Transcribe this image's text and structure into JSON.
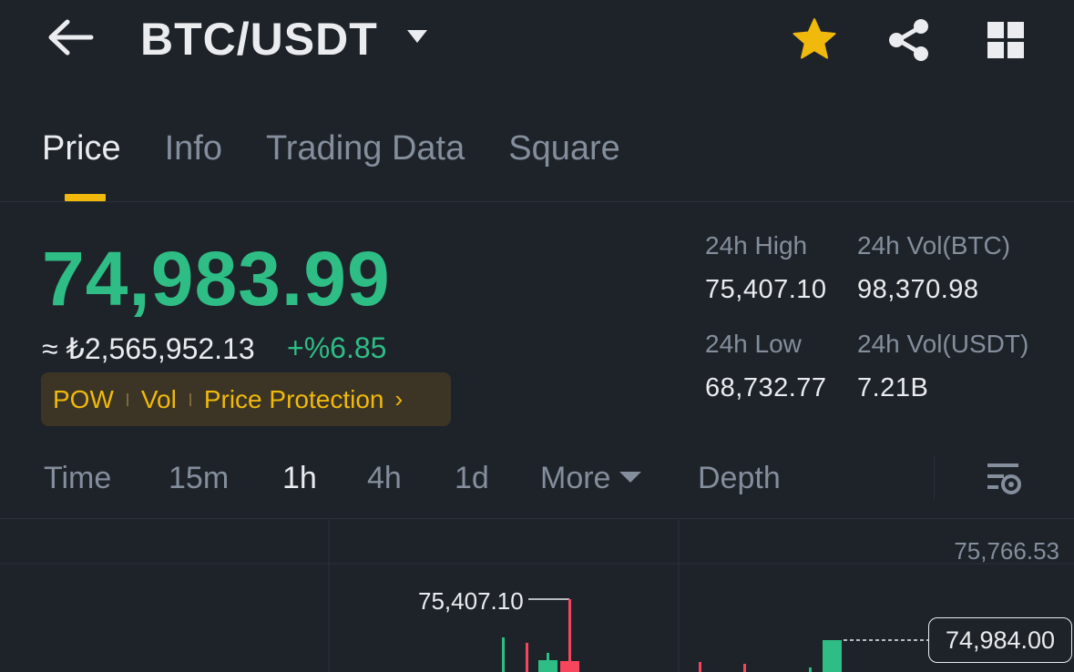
{
  "header": {
    "pair": "BTC/USDT",
    "icons": [
      "back-arrow-icon",
      "caret-down-icon",
      "star-icon",
      "share-icon",
      "grid-icon"
    ],
    "favorite_color": "#f0b90b"
  },
  "tabs": [
    {
      "label": "Price",
      "active": true
    },
    {
      "label": "Info",
      "active": false
    },
    {
      "label": "Trading Data",
      "active": false
    },
    {
      "label": "Square",
      "active": false
    }
  ],
  "price": {
    "last": "74,983.99",
    "fiat": "≈ ₺2,565,952.13",
    "change": "+%6.85",
    "up_color": "#2ebd85",
    "down_color": "#f6465d"
  },
  "tags": {
    "pow": "POW",
    "vol": "Vol",
    "protection": "Price Protection",
    "chevron": "›"
  },
  "stats": {
    "high_label": "24h High",
    "high_value": "75,407.10",
    "vol_btc_label": "24h Vol(BTC)",
    "vol_btc_value": "98,370.98",
    "low_label": "24h Low",
    "low_value": "68,732.77",
    "vol_usdt_label": "24h Vol(USDT)",
    "vol_usdt_value": "7.21B"
  },
  "intervals": [
    {
      "label": "Time",
      "active": false
    },
    {
      "label": "15m",
      "active": false
    },
    {
      "label": "1h",
      "active": true
    },
    {
      "label": "4h",
      "active": false
    },
    {
      "label": "1d",
      "active": false
    },
    {
      "label": "More",
      "active": false
    },
    {
      "label": "Depth",
      "active": false
    }
  ],
  "chart": {
    "axis_high": "75,766.53",
    "high_marker": "75,407.10",
    "current_price": "74,984.00"
  }
}
